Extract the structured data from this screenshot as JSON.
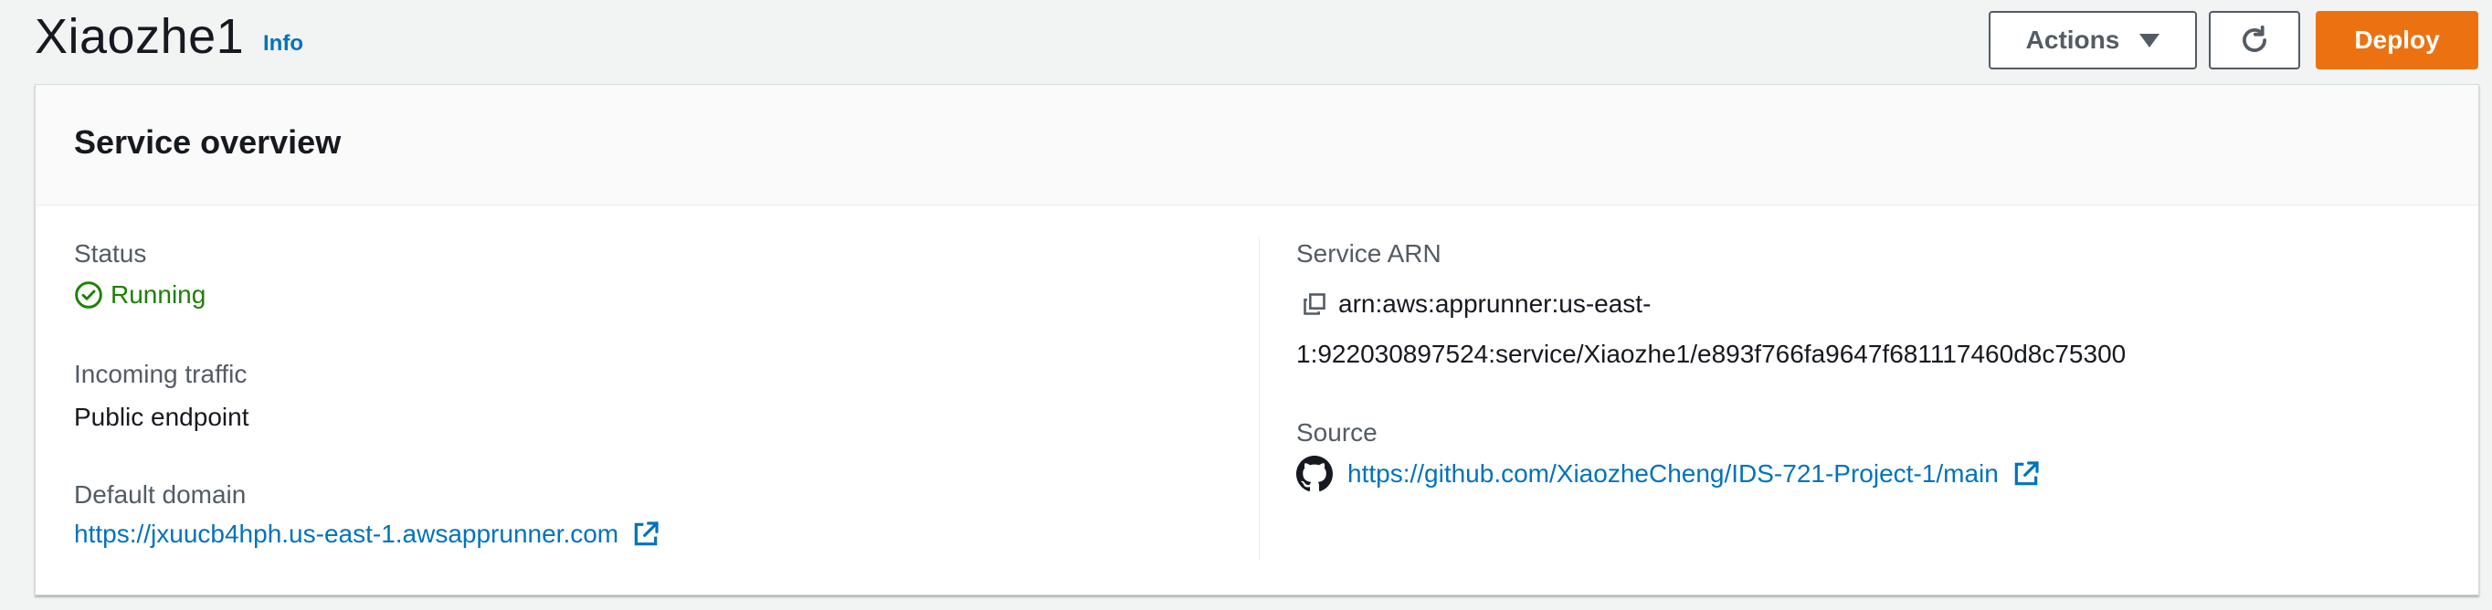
{
  "header": {
    "title": "Xiaozhe1",
    "info_label": "Info",
    "actions_label": "Actions",
    "deploy_label": "Deploy"
  },
  "overview": {
    "title": "Service overview",
    "status_label": "Status",
    "status_value": "Running",
    "incoming_label": "Incoming traffic",
    "incoming_value": "Public endpoint",
    "domain_label": "Default domain",
    "domain_url": "https://jxuucb4hph.us-east-1.awsapprunner.com",
    "arn_label": "Service ARN",
    "arn_line1": "arn:aws:apprunner:us-east-",
    "arn_line2": "1:922030897524:service/Xiaozhe1/e893f766fa9647f681117460d8c75300",
    "source_label": "Source",
    "source_url": "https://github.com/XiaozheCheng/IDS-721-Project-1/main"
  },
  "colors": {
    "primary": "#ec7211",
    "link": "#0073bb",
    "success": "#1d8102",
    "text": "#16191f",
    "label": "#545b64"
  },
  "icons": [
    "caret-down-icon",
    "refresh-icon",
    "check-circle-icon",
    "external-link-icon",
    "copy-icon",
    "github-icon"
  ]
}
